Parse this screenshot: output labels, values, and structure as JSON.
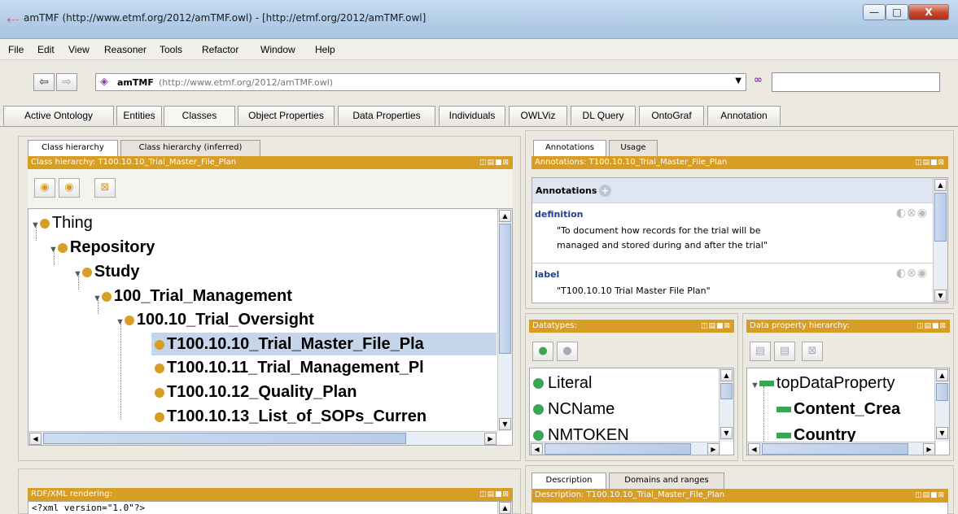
{
  "window": {
    "title": "amTMF (http://www.etmf.org/2012/amTMF.owl) - [http://etmf.org/2012/amTMF.owl]",
    "close_glyph": "X"
  },
  "menu": [
    "File",
    "Edit",
    "View",
    "Reasoner",
    "Tools",
    "Refactor",
    "Window",
    "Help"
  ],
  "nav": {
    "back_glyph": "⇦",
    "forward_glyph": "⇨",
    "ontology_name": "amTMF",
    "ontology_iri": "(http://www.etmf.org/2012/amTMF.owl)",
    "search_value": ""
  },
  "tabs": [
    "Active Ontology",
    "Entities",
    "Classes",
    "Object Properties",
    "Data Properties",
    "Individuals",
    "OWLViz",
    "DL Query",
    "OntoGraf",
    "Annotation"
  ],
  "active_tab": "Classes",
  "class_panel": {
    "tabs": [
      "Class hierarchy",
      "Class hierarchy (inferred)"
    ],
    "header": "Class hierarchy: T100.10.10_Trial_Master_File_Plan",
    "tree": [
      {
        "label": "Thing",
        "level": 0,
        "bold": false
      },
      {
        "label": "Repository",
        "level": 1,
        "bold": true
      },
      {
        "label": "Study",
        "level": 2,
        "bold": true
      },
      {
        "label": "100_Trial_Management",
        "level": 3,
        "bold": true
      },
      {
        "label": "100.10_Trial_Oversight",
        "level": 4,
        "bold": true
      },
      {
        "label": "T100.10.10_Trial_Master_File_Pla",
        "level": 5,
        "bold": true,
        "selected": true
      },
      {
        "label": "T100.10.11_Trial_Management_Pl",
        "level": 5,
        "bold": true
      },
      {
        "label": "T100.10.12_Quality_Plan",
        "level": 5,
        "bold": true
      },
      {
        "label": "T100.10.13_List_of_SOPs_Curren",
        "level": 5,
        "bold": true
      }
    ]
  },
  "annotations_panel": {
    "tabs": [
      "Annotations",
      "Usage"
    ],
    "header": "Annotations: T100.10.10_Trial_Master_File_Plan",
    "section_label": "Annotations",
    "entries": [
      {
        "property": "definition",
        "value_line1": "\"To document how records for the trial will be",
        "value_line2": "managed and stored during and after the trial\""
      },
      {
        "property": "label",
        "value_line1": "\"T100.10.10 Trial Master File Plan\"",
        "value_line2": ""
      }
    ]
  },
  "datatypes_panel": {
    "header": "Datatypes:",
    "items": [
      "Literal",
      "NCName",
      "NMTOKEN"
    ]
  },
  "data_property_panel": {
    "header": "Data property hierarchy:",
    "items": [
      "topDataProperty",
      "Content_Crea",
      "Country"
    ]
  },
  "rdf_panel": {
    "header": "RDF/XML rendering:",
    "content": "<?xml version=\"1.0\"?>"
  },
  "description_panel": {
    "tabs": [
      "Description",
      "Domains and ranges"
    ],
    "header": "Description: T100.10.10_Trial_Master_File_Plan"
  },
  "colors": {
    "panel_header": "#d79d25",
    "selection": "#c5d5ea",
    "class_dot": "#d79d25",
    "datatype_dot": "#3aa552",
    "annotation_property": "#1f3f8f"
  }
}
